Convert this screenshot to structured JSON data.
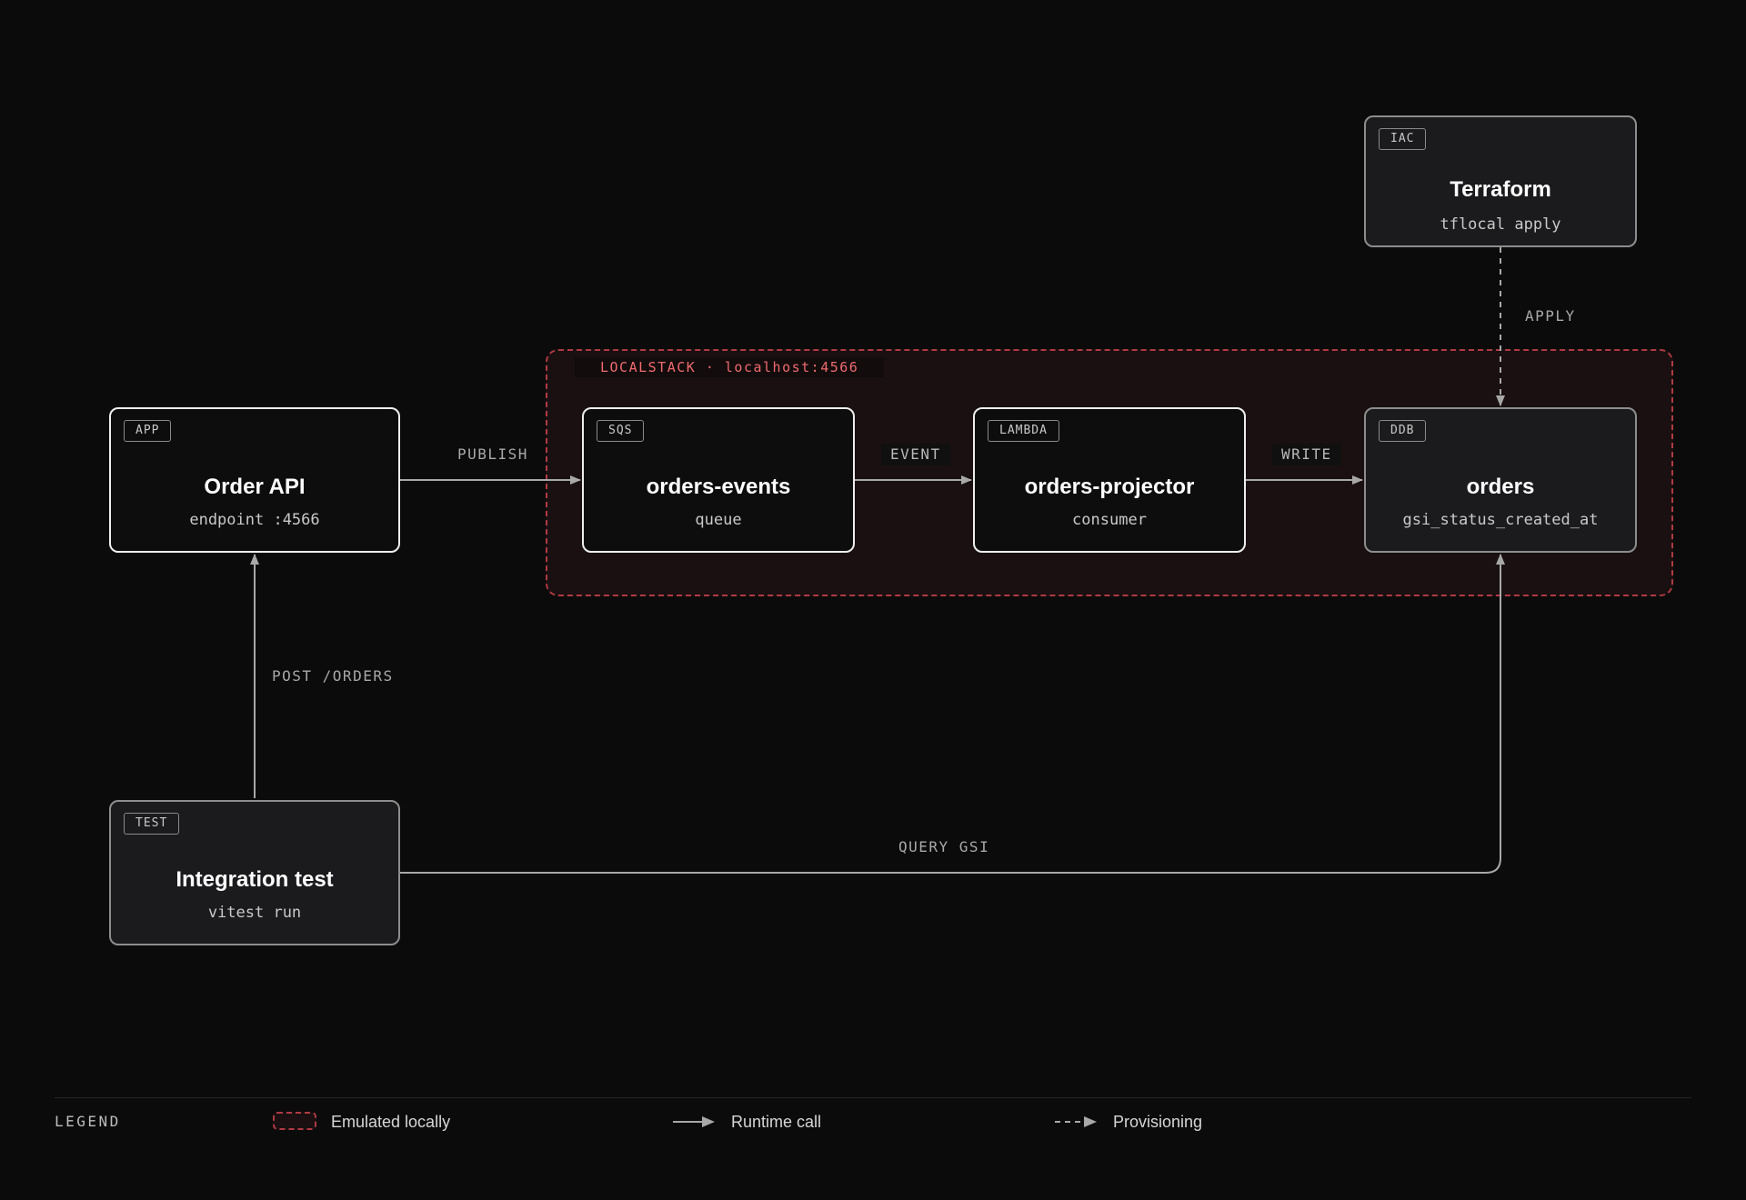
{
  "colors": {
    "background": "#0b0b0b",
    "node_border": "#eeeeee",
    "node_border_muted": "#8d8d8d",
    "emulated_zone_border": "#b03a43",
    "emulated_zone_label": "#f06a6f",
    "edge": "#a8a8a8"
  },
  "zone": {
    "label": "LOCALSTACK · localhost:4566"
  },
  "nodes": {
    "order_api": {
      "tag": "APP",
      "title": "Order API",
      "sub": "endpoint :4566"
    },
    "orders_events": {
      "tag": "SQS",
      "title": "orders-events",
      "sub": "queue"
    },
    "orders_projector": {
      "tag": "LAMBDA",
      "title": "orders-projector",
      "sub": "consumer"
    },
    "orders_table": {
      "tag": "DDB",
      "title": "orders",
      "sub": "gsi_status_created_at"
    },
    "terraform": {
      "tag": "IAC",
      "title": "Terraform",
      "sub": "tflocal apply"
    },
    "integration_test": {
      "tag": "TEST",
      "title": "Integration test",
      "sub": "vitest run"
    }
  },
  "edges": {
    "publish": "PUBLISH",
    "event": "EVENT",
    "write": "WRITE",
    "apply": "APPLY",
    "post_orders": "POST /ORDERS",
    "query_gsi": "QUERY GSI"
  },
  "legend": {
    "title": "LEGEND",
    "emulated": "Emulated locally",
    "runtime": "Runtime call",
    "provisioning": "Provisioning"
  }
}
